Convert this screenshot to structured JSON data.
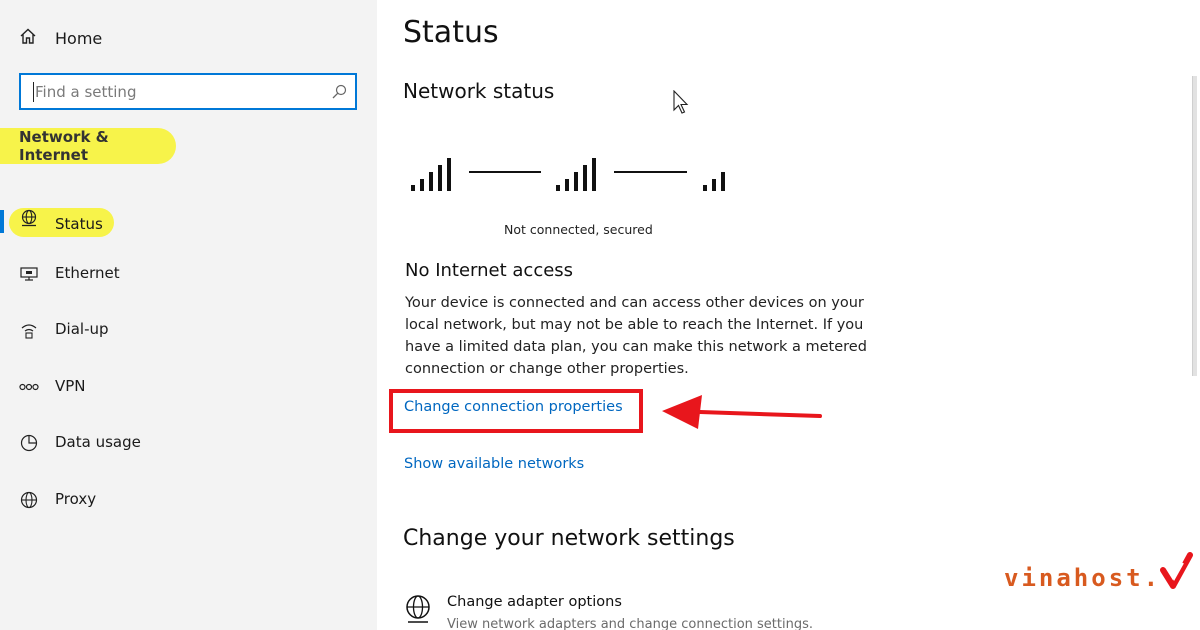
{
  "sidebar": {
    "home_label": "Home",
    "search_placeholder": "Find a setting",
    "section_heading": "Network & Internet",
    "items": [
      {
        "label": "Status",
        "icon": "globe-status-icon"
      },
      {
        "label": "Ethernet",
        "icon": "ethernet-icon"
      },
      {
        "label": "Dial-up",
        "icon": "dialup-icon"
      },
      {
        "label": "VPN",
        "icon": "vpn-icon"
      },
      {
        "label": "Data usage",
        "icon": "data-usage-icon"
      },
      {
        "label": "Proxy",
        "icon": "globe-icon"
      }
    ],
    "selected": "Status"
  },
  "main": {
    "title": "Status",
    "network_status_heading": "Network status",
    "connection_status": "Not connected, secured",
    "no_internet_heading": "No Internet access",
    "description": "Your device is connected and can access other devices on your local network, but may not be able to reach the Internet. If you have a limited data plan, you can make this network a metered connection or change other properties.",
    "change_connection_link": "Change connection properties",
    "show_networks_link": "Show available networks",
    "change_settings_heading": "Change your network settings",
    "adapter_options": {
      "title": "Change adapter options",
      "description": "View network adapters and change connection settings."
    }
  },
  "watermark": {
    "text": "vinahost."
  },
  "colors": {
    "accent": "#0078d7",
    "link": "#0067c0",
    "highlight": "#f7f34a",
    "annotation": "#e8161c",
    "watermark": "#d85a1f"
  }
}
